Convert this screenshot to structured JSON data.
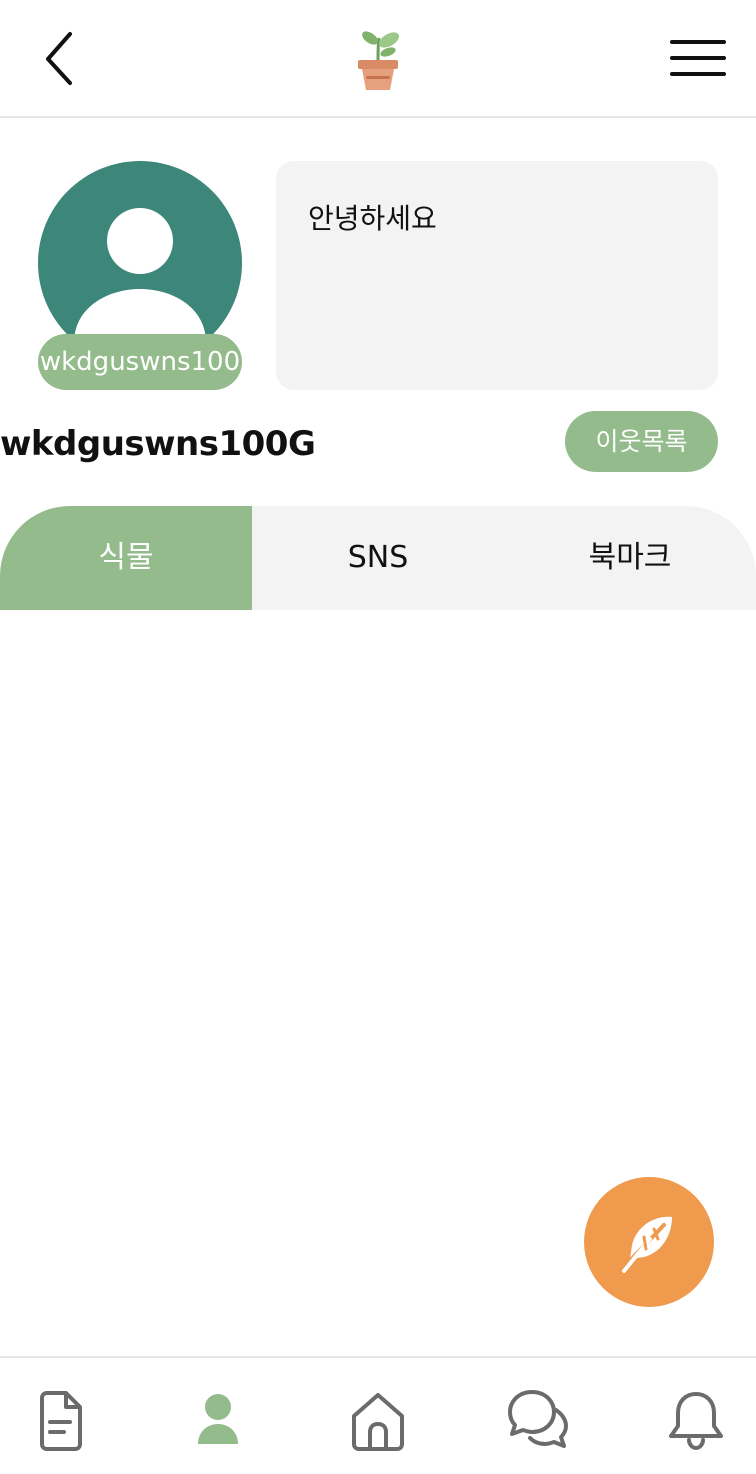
{
  "header": {
    "back_icon": "chevron-left-icon",
    "logo_icon": "potted-plant-icon",
    "menu_icon": "hamburger-menu-icon"
  },
  "profile": {
    "avatar_icon": "user-silhouette-icon",
    "avatar_tag": "wkdguswns100",
    "bio": "안녕하세요",
    "username": "wkdguswns100G",
    "neighbors_button": "이웃목록"
  },
  "tabs": [
    {
      "label": "식물",
      "active": true
    },
    {
      "label": "SNS",
      "active": false
    },
    {
      "label": "북마크",
      "active": false
    }
  ],
  "fab": {
    "icon": "feather-icon"
  },
  "bottom_nav": [
    {
      "icon": "document-icon",
      "active": false
    },
    {
      "icon": "user-icon",
      "active": true
    },
    {
      "icon": "home-icon",
      "active": false
    },
    {
      "icon": "chat-icon",
      "active": false
    },
    {
      "icon": "bell-icon",
      "active": false
    }
  ],
  "colors": {
    "accent_green": "#93bb8b",
    "avatar_teal": "#3c867a",
    "fab_orange": "#ef9a4c",
    "panel_gray": "#f3f3f3",
    "icon_gray": "#6b6b6b"
  }
}
